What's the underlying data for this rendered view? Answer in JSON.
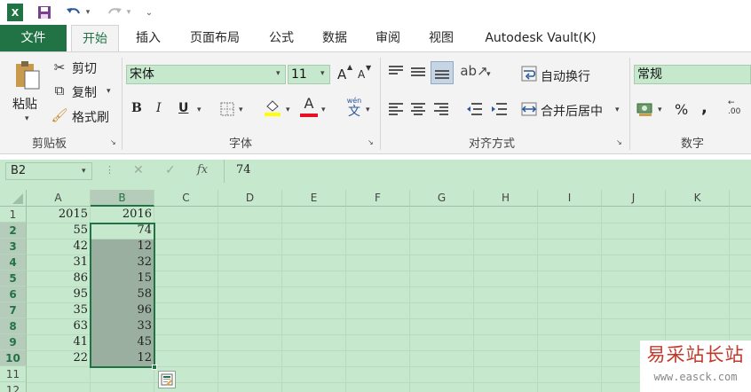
{
  "qat": {
    "icons": [
      "excel-logo",
      "save",
      "undo",
      "redo",
      "customize"
    ]
  },
  "tabs": [
    "文件",
    "开始",
    "插入",
    "页面布局",
    "公式",
    "数据",
    "审阅",
    "视图",
    "Autodesk Vault(K)"
  ],
  "ribbon": {
    "clipboard": {
      "paste": "粘贴",
      "cut": "剪切",
      "copy": "复制",
      "format_painter": "格式刷",
      "group": "剪贴板"
    },
    "font": {
      "name": "宋体",
      "size": "11",
      "bold": "B",
      "italic": "I",
      "underline": "U",
      "font_color_glyph": "A",
      "phonetic": "wén",
      "phonetic_char": "文",
      "grow": "A",
      "shrink": "A",
      "group": "字体"
    },
    "alignment": {
      "wrap_text": "自动换行",
      "merge_center": "合并后居中",
      "group": "对齐方式"
    },
    "number": {
      "format": "常规",
      "percent": "%",
      "comma": ",",
      "group": "数字"
    }
  },
  "formula_bar": {
    "name_box": "B2",
    "fx": "fx",
    "value": "74"
  },
  "sheet": {
    "columns": [
      "A",
      "B",
      "C",
      "D",
      "E",
      "F",
      "G",
      "H",
      "I",
      "J",
      "K"
    ],
    "rows": [
      "1",
      "2",
      "3",
      "4",
      "5",
      "6",
      "7",
      "8",
      "9",
      "10",
      "11",
      "12"
    ],
    "col_a": [
      "2015",
      "55",
      "42",
      "31",
      "86",
      "95",
      "35",
      "63",
      "41",
      "22"
    ],
    "col_b": [
      "2016",
      "74",
      "12",
      "32",
      "15",
      "58",
      "96",
      "33",
      "45",
      "12"
    ],
    "selection": "B2:B10"
  },
  "watermark": {
    "cn": "易采站长站",
    "url": "www.easck.com"
  },
  "colors": {
    "excel_green": "#217346",
    "sheet_bg": "#c6e8cd",
    "selection_fill": "#9aaf9f"
  }
}
